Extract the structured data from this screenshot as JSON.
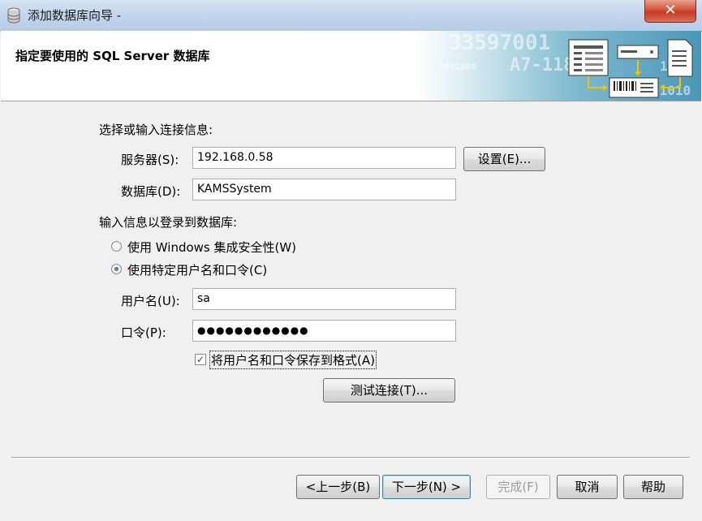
{
  "window": {
    "title": "添加数据库向导 -",
    "close_symbol": "✕"
  },
  "header": {
    "title": "指定要使用的 SQL Server 数据库",
    "banner_text": [
      "33597001",
      "A7-118",
      "MAY2000",
      "1010",
      "01010"
    ]
  },
  "connection": {
    "label": "选择或输入连接信息:",
    "server_label": "服务器(S):",
    "server_value": "192.168.0.58",
    "settings_button": "设置(E)...",
    "database_label": "数据库(D):",
    "database_value": "KAMSSystem"
  },
  "login": {
    "label": "输入信息以登录到数据库:",
    "option_windows": "使用 Windows 集成安全性(W)",
    "option_specific": "使用特定用户名和口令(C)",
    "selected": "specific",
    "username_label": "用户名(U):",
    "username_value": "sa",
    "password_label": "口令(P):",
    "password_value": "●●●●●●●●●●●●",
    "save_label": "将用户名和口令保存到格式(A)",
    "save_checked": true,
    "test_button": "测试连接(T)..."
  },
  "footer": {
    "back_button": "<上一步(B)",
    "next_button": "下一步(N) >",
    "finish_button": "完成(F)",
    "cancel_button": "取消",
    "help_button": "帮助"
  }
}
